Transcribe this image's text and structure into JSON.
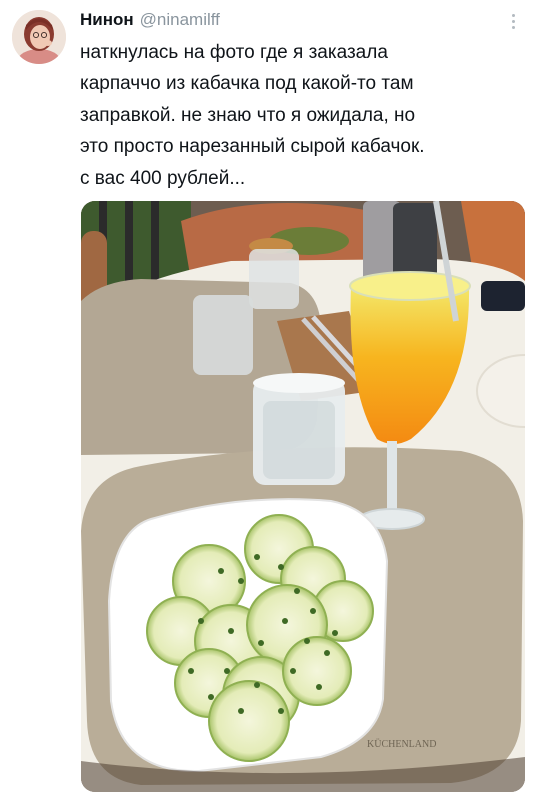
{
  "tweet": {
    "display_name": "Нинон",
    "handle": "@ninamilff",
    "text": "наткнулась на фото где я заказала\nкарпаччо из кабачка под какой-то там\nзаправкой. не знаю что я ожидала, но\nэто просто нарезанный сырой кабачок.\nс вас 400 рублей..."
  },
  "photo": {
    "placemat_brand": "KÜCHENLAND"
  },
  "icons": {
    "avatar": "avatar-photo",
    "more": "more-vertical-icon"
  }
}
